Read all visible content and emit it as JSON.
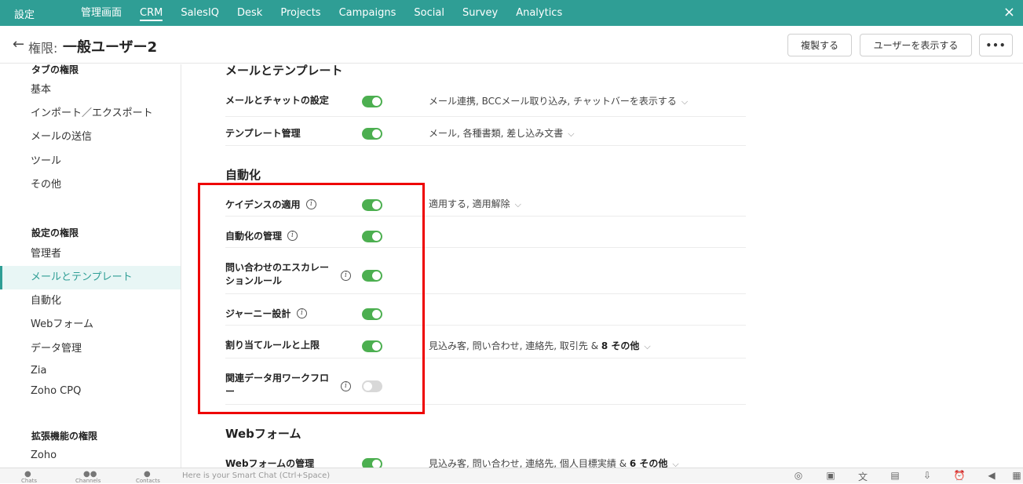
{
  "topbar": {
    "settings": "設定",
    "nav": [
      "管理画面",
      "CRM",
      "SalesIQ",
      "Desk",
      "Projects",
      "Campaigns",
      "Social",
      "Survey",
      "Analytics"
    ],
    "active": "CRM",
    "close_icon": "×"
  },
  "header": {
    "back_icon": "←",
    "crumb": "権限:",
    "title": "一般ユーザー2",
    "duplicate_label": "複製する",
    "show_users_label": "ユーザーを表示する",
    "more_label": "•••"
  },
  "sidebar": {
    "tab_heading": "タブの権限",
    "tab_items": [
      "基本",
      "インポート／エクスポート",
      "メールの送信",
      "ツール",
      "その他"
    ],
    "settings_heading": "設定の権限",
    "settings_items": [
      "管理者",
      "メールとテンプレート",
      "自動化",
      "Webフォーム",
      "データ管理",
      "Zia",
      "Zoho CPQ"
    ],
    "active_item": "メールとテンプレート",
    "ext_heading": "拡張機能の権限",
    "ext_items": [
      "Zoho"
    ]
  },
  "main": {
    "mail_section": "メールとテンプレート",
    "mail_rows": [
      {
        "label": "メールとチャットの設定",
        "on": true,
        "detail": "メール連携, BCCメール取り込み, チャットバーを表示する"
      },
      {
        "label": "テンプレート管理",
        "on": true,
        "detail": "メール, 各種書類, 差し込み文書"
      }
    ],
    "auto_section": "自動化",
    "auto_rows": [
      {
        "label": "ケイデンスの適用",
        "info": true,
        "on": true,
        "detail": "適用する, 適用解除"
      },
      {
        "label": "自動化の管理",
        "info": true,
        "on": true,
        "detail": ""
      },
      {
        "label": "問い合わせのエスカレーションルール",
        "info": true,
        "on": true,
        "detail": ""
      },
      {
        "label": "ジャーニー設計",
        "info": true,
        "on": true,
        "detail": ""
      },
      {
        "label": "割り当てルールと上限",
        "info": false,
        "on": true,
        "detail": "見込み客, 問い合わせ, 連絡先, 取引先 &",
        "extra": "8 その他"
      },
      {
        "label": "関連データ用ワークフロー",
        "info": true,
        "on": false,
        "detail": ""
      }
    ],
    "web_section": "Webフォーム",
    "web_rows": [
      {
        "label": "Webフォームの管理",
        "on": true,
        "detail": "見込み客, 問い合わせ, 連絡先, 個人目標実績 &",
        "extra": "6 その他"
      }
    ],
    "label_line1": "問い合わせのエスカレー",
    "label_line2": "ションルール",
    "label2_line1": "関連データ用ワークフロ",
    "label2_line2": "ー"
  },
  "bottombar": {
    "items": [
      "Chats",
      "Channels",
      "Contacts"
    ],
    "smartchat_placeholder": "Here is your Smart Chat (Ctrl+Space)"
  },
  "colors": {
    "brand": "#2f9e95",
    "toggle_on": "#4caf50",
    "highlight_box": "#e00000"
  }
}
